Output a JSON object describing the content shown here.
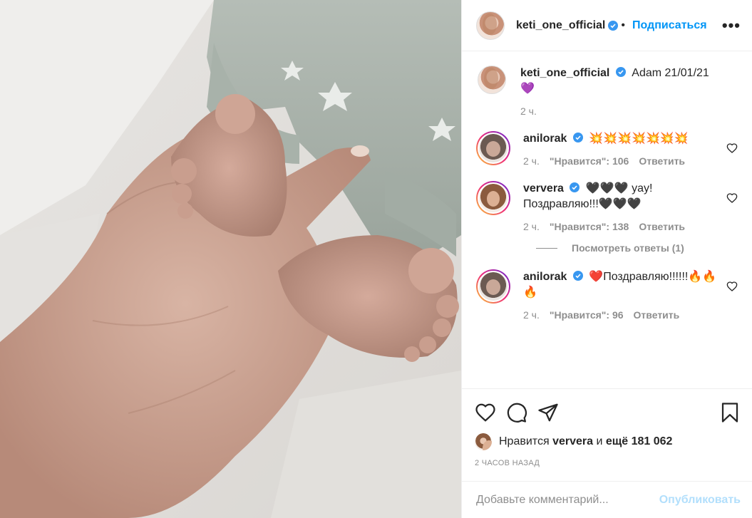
{
  "post": {
    "author": "keti_one_official",
    "follow_label": "Подписаться",
    "more_label": "•••",
    "caption": "Adam 21/01/21💜",
    "caption_time": "2 ч.",
    "likes": {
      "prefix": "Нравится",
      "user": "ververa",
      "conjunction": "и",
      "count": "ещё 181 062"
    },
    "timestamp": "2 ЧАСОВ НАЗАД"
  },
  "comments": [
    {
      "user": "anilorak",
      "text": "💥💥💥💥💥💥💥",
      "time": "2 ч.",
      "likes": "\"Нравится\": 106",
      "reply": "Ответить"
    },
    {
      "user": "ververa",
      "text": "🖤🖤🖤 yay! Поздравляю!!!🖤🖤🖤",
      "time": "2 ч.",
      "likes": "\"Нравится\": 138",
      "reply": "Ответить"
    },
    {
      "user": "anilorak",
      "text": "❤️Поздравляю!!!!!!🔥🔥🔥",
      "time": "2 ч.",
      "likes": "\"Нравится\": 96",
      "reply": "Ответить"
    }
  ],
  "view_replies": "Посмотреть ответы (1)",
  "add_comment": {
    "placeholder": "Добавьте комментарий...",
    "post_label": "Опубликовать"
  },
  "icons": [
    "heart-icon",
    "comment-icon",
    "share-icon",
    "save-icon",
    "verified-icon"
  ],
  "colors": {
    "accent": "#0095f6",
    "verified": "#3897f0",
    "muted": "#8e8e8e",
    "disabled_post": "#b2dffc"
  }
}
